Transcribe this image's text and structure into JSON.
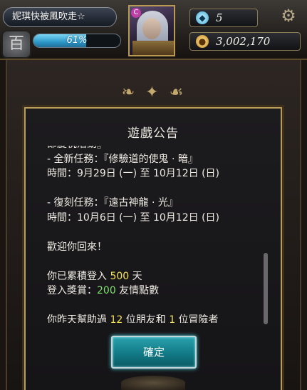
{
  "hud": {
    "player_name": "妮琪快被風吹走☆",
    "badge_char": "百",
    "exp_percent": 61,
    "exp_label": "61%",
    "rank_glyph": "C",
    "gems_icon": "gem-icon",
    "gems": "5",
    "gold_icon": "coin-icon",
    "gold": "3,002,170",
    "settings_icon": "gear-icon"
  },
  "dialog": {
    "title": "遊戲公告",
    "lines": [
      "節慶祝活動』",
      " - 全新任務：『修驗道的使鬼 · 暗』",
      "時間：9月29日 (一) 至 10月12日 (日)",
      "",
      " - 復刻任務：『遠古神龍 · 光』",
      "時間：10月6日 (一) 至 10月12日 (日)",
      "",
      "歡迎你回來！",
      ""
    ],
    "login_prefix": "你已累積登入 ",
    "login_days": "500",
    "login_suffix": " 天",
    "reward_prefix": "登入獎賞：",
    "reward_points": "200",
    "reward_suffix": " 友情點數",
    "help_prefix": "你昨天幫助過 ",
    "help_friends": "12",
    "help_mid": " 位朋友和 ",
    "help_adventurers": "1",
    "help_suffix": " 位冒險者",
    "confirm_label": "確定"
  },
  "colors": {
    "accent_gold": "#b99b5c",
    "highlight_yellow": "#f6e25a",
    "highlight_green": "#7ee06e",
    "button_teal": "#117a86"
  }
}
